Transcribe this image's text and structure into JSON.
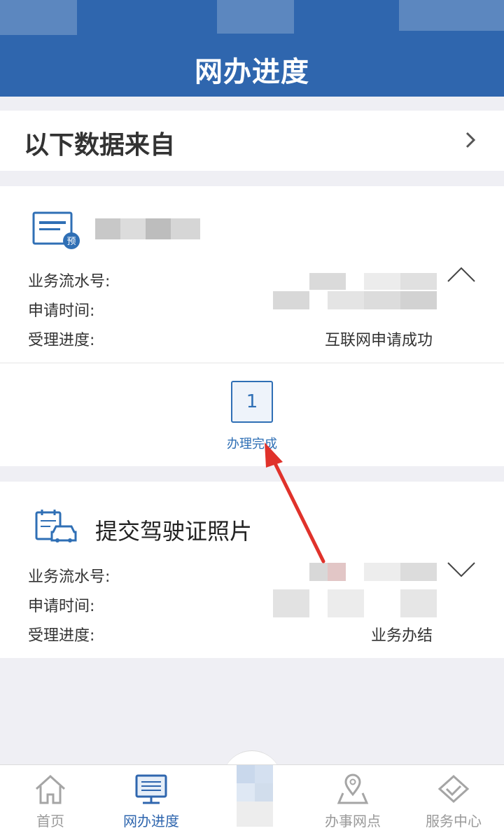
{
  "header": {
    "title": "网办进度"
  },
  "source": {
    "label": "以下数据来自"
  },
  "record1": {
    "fields": [
      {
        "label": "业务流水号:",
        "value": ""
      },
      {
        "label": "申请时间:",
        "value": ""
      },
      {
        "label": "受理进度:",
        "value": "互联网申请成功"
      }
    ],
    "icon_badge": "预",
    "step": {
      "number": "1",
      "label": "办理完成"
    }
  },
  "record2": {
    "title": "提交驾驶证照片",
    "fields": [
      {
        "label": "业务流水号:",
        "value": ""
      },
      {
        "label": "申请时间:",
        "value": ""
      },
      {
        "label": "受理进度:",
        "value": "业务办结"
      }
    ]
  },
  "tabbar": {
    "items": [
      {
        "label": "首页",
        "icon": "home-icon",
        "active": false
      },
      {
        "label": "网办进度",
        "icon": "monitor-icon",
        "active": true
      },
      {
        "label": "",
        "icon": "center-icon",
        "active": false
      },
      {
        "label": "办事网点",
        "icon": "location-map-icon",
        "active": false
      },
      {
        "label": "服务中心",
        "icon": "handshake-icon",
        "active": false
      }
    ]
  },
  "colors": {
    "primary": "#2f66ae",
    "annotation_arrow": "#e0322b",
    "text": "#333333",
    "inactive": "#9a9a9a"
  }
}
